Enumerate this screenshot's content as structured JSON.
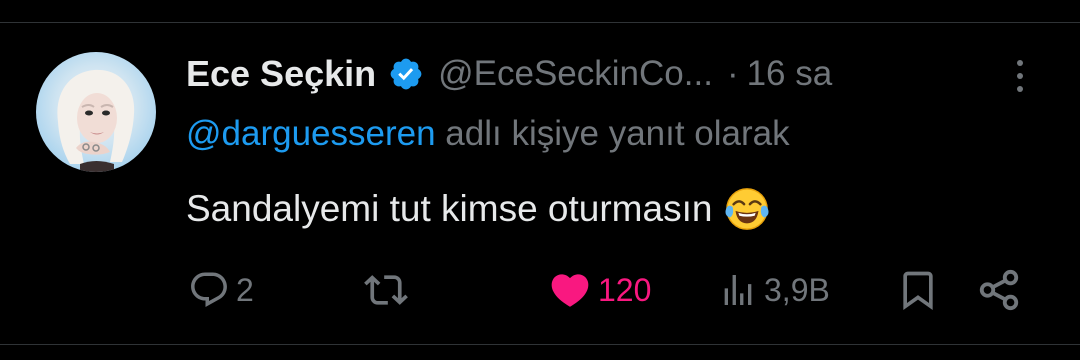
{
  "tweet": {
    "author": {
      "display_name": "Ece Seçkin",
      "handle": "@EceSeckinCo...",
      "verified": true,
      "avatar_icon": "profile-photo"
    },
    "separator": "·",
    "time": "16 sa",
    "reply_to": {
      "mention": "@darguesseren",
      "text": " adlı kişiye yanıt olarak"
    },
    "text": "Sandalyemi tut kimse oturmasın",
    "emoji": "face-with-tears-of-joy"
  },
  "actions": {
    "reply": {
      "icon": "reply-icon",
      "count": "2"
    },
    "retweet": {
      "icon": "retweet-icon",
      "count": ""
    },
    "like": {
      "icon": "heart-icon",
      "count": "120",
      "active": true
    },
    "views": {
      "icon": "views-icon",
      "count": "3,9B"
    },
    "bookmark": {
      "icon": "bookmark-icon"
    },
    "share": {
      "icon": "share-icon"
    }
  },
  "colors": {
    "background": "#000000",
    "text_primary": "#e7e9ea",
    "text_secondary": "#71767b",
    "accent_blue": "#1d9bf0",
    "like_pink": "#f91880"
  }
}
